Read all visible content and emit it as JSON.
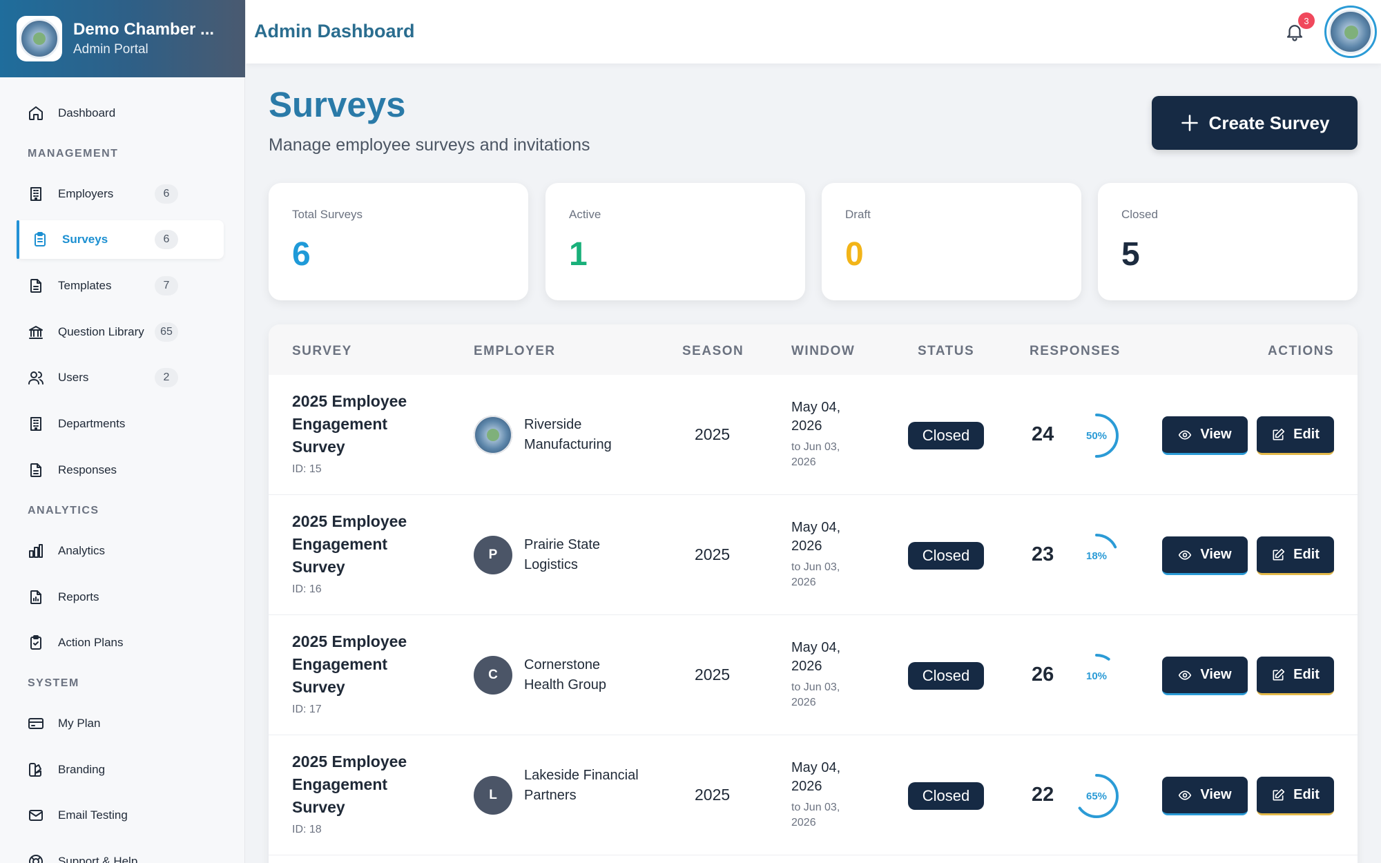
{
  "brand": {
    "title": "Demo Chamber ...",
    "subtitle": "Admin Portal"
  },
  "header": {
    "title": "Admin Dashboard",
    "notification_count": "3"
  },
  "sidebar": {
    "dashboard": {
      "label": "Dashboard",
      "icon": "home-icon"
    },
    "sections": {
      "management": "MANAGEMENT",
      "analytics": "ANALYTICS",
      "system": "SYSTEM"
    },
    "items": [
      {
        "label": "Employers",
        "count": "6",
        "icon": "building-icon"
      },
      {
        "label": "Surveys",
        "count": "6",
        "icon": "clipboard-icon",
        "active": true
      },
      {
        "label": "Templates",
        "count": "7",
        "icon": "document-icon"
      },
      {
        "label": "Question Library",
        "count": "65",
        "icon": "library-icon"
      },
      {
        "label": "Users",
        "count": "2",
        "icon": "users-icon"
      },
      {
        "label": "Departments",
        "icon": "building-icon"
      },
      {
        "label": "Responses",
        "icon": "document-icon"
      },
      {
        "label": "Analytics",
        "icon": "bar-chart-icon"
      },
      {
        "label": "Reports",
        "icon": "report-icon"
      },
      {
        "label": "Action Plans",
        "icon": "clipboard-check-icon"
      },
      {
        "label": "My Plan",
        "icon": "credit-card-icon"
      },
      {
        "label": "Branding",
        "icon": "palette-icon"
      },
      {
        "label": "Email Testing",
        "icon": "mail-icon"
      },
      {
        "label": "Support & Help",
        "icon": "lifebuoy-icon"
      }
    ]
  },
  "page": {
    "title": "Surveys",
    "subtitle": "Manage employee surveys and invitations",
    "create_label": "Create Survey"
  },
  "stats": [
    {
      "label": "Total Surveys",
      "value": "6",
      "color": "#1f9ad8"
    },
    {
      "label": "Active",
      "value": "1",
      "color": "#19b07a"
    },
    {
      "label": "Draft",
      "value": "0",
      "color": "#f2b418"
    },
    {
      "label": "Closed",
      "value": "5",
      "color": "#1c2b3f"
    }
  ],
  "table": {
    "headers": [
      "SURVEY",
      "EMPLOYER",
      "SEASON",
      "WINDOW",
      "STATUS",
      "RESPONSES",
      "ACTIONS"
    ],
    "view_label": "View",
    "edit_label": "Edit",
    "rows": [
      {
        "name": "2025 Employee Engagement Survey",
        "id": "ID: 15",
        "employer": "Riverside Manufacturing",
        "employer_initial": "",
        "season": "2025",
        "window_start": "May 04, 2026",
        "window_end": "to Jun 03, 2026",
        "status": "Closed",
        "responses": "24",
        "rate_label": "50%",
        "rate": 0.5
      },
      {
        "name": "2025 Employee Engagement Survey",
        "id": "ID: 16",
        "employer": "Prairie State Logistics",
        "employer_initial": "P",
        "season": "2025",
        "window_start": "May 04, 2026",
        "window_end": "to Jun 03, 2026",
        "status": "Closed",
        "responses": "23",
        "rate_label": "18%",
        "rate": 0.18
      },
      {
        "name": "2025 Employee Engagement Survey",
        "id": "ID: 17",
        "employer": "Cornerstone Health Group",
        "employer_initial": "C",
        "season": "2025",
        "window_start": "May 04, 2026",
        "window_end": "to Jun 03, 2026",
        "status": "Closed",
        "responses": "26",
        "rate_label": "10%",
        "rate": 0.1
      },
      {
        "name": "2025 Employee Engagement Survey",
        "id": "ID: 18",
        "employer": "Lakeside Financial Partners",
        "employer_initial": "L",
        "season": "2025",
        "window_start": "May 04, 2026",
        "window_end": "to Jun 03, 2026",
        "status": "Closed",
        "responses": "22",
        "rate_label": "65%",
        "rate": 0.65
      }
    ]
  }
}
